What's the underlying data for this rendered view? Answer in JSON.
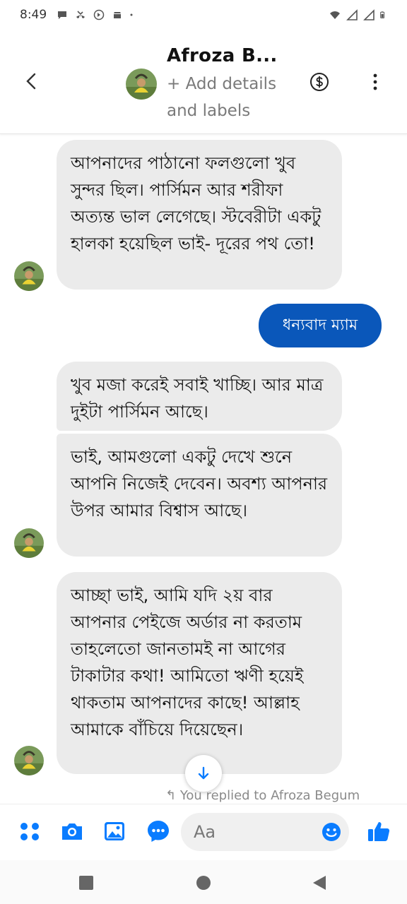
{
  "status_bar": {
    "time": "8:49"
  },
  "header": {
    "contact_name": "Afroza B...",
    "add_details": "+ Add details and labels",
    "icons": [
      "back-icon",
      "dollar-icon",
      "more-vertical-icon"
    ]
  },
  "messages": [
    {
      "direction": "received",
      "text": "আপনাদের পাঠানো ফলগুলো খুব সুন্দর ছিল। পার্সিমন আর শরীফা অত্যন্ত ভাল লেগেছে। স্টবেরীটা একটু হালকা হয়েছিল ভাই- দূরের পথ তো!"
    },
    {
      "direction": "sent",
      "text": "ধন্যবাদ ম্যাম"
    },
    {
      "direction": "received",
      "text": "খুব মজা করেই সবাই খাচ্ছি। আর মাত্র দুইটা পার্সিমন আছে।"
    },
    {
      "direction": "received",
      "text": "ভাই, আমগুলো একটু দেখে শুনে আপনি নিজেই দেবেন। অবশ্য আপনার উপর আমার বিশ্বাস আছে।"
    },
    {
      "direction": "received",
      "text": "আচ্ছা ভাই, আমি যদি ২য় বার আপনার পেইজে অর্ডার না করতাম তাহলেতো জানতামই না আগের টাকাটার কথা! আমিতো ঋণী হয়েই থাকতাম আপনাদের কাছে! আল্লাহ আমাকে বাঁচিয়ে দিয়েছেন।"
    }
  ],
  "replied_note": "You replied to Afroza Begum",
  "composer": {
    "placeholder": "Aa",
    "icons": [
      "apps-icon",
      "camera-icon",
      "gallery-icon",
      "chat-bubble-icon",
      "emoji-icon",
      "thumbs-up-icon"
    ]
  },
  "colors": {
    "accent": "#0a7cff",
    "sent_bubble": "#0a57ba",
    "received_bubble": "#ebebeb"
  }
}
